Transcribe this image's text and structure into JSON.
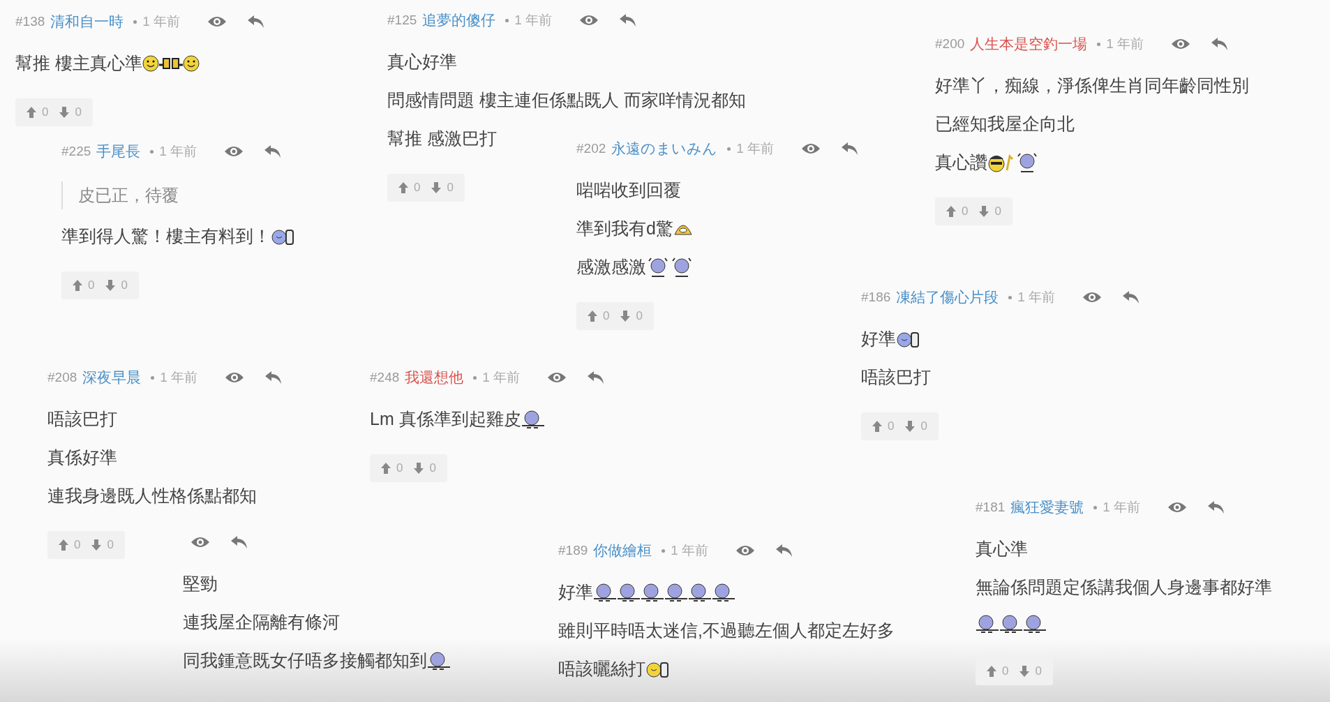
{
  "comments": [
    {
      "number": "#138",
      "name": "清和自一時",
      "color": "#4a90c8",
      "time": "1 年前",
      "lines": [
        {
          "kind": "text",
          "text": "幫推 樓主真心準",
          "emoticons": [
            {
              "kind": "smiley"
            },
            {
              "kind": "cheers"
            },
            {
              "kind": "smiley"
            }
          ]
        }
      ],
      "votes": {
        "up": "0",
        "down": "0"
      }
    },
    {
      "number": "#225",
      "name": "手尾長",
      "color": "#4a90c8",
      "time": "1 年前",
      "lines": [
        {
          "kind": "quote",
          "text": "皮已正，待覆"
        },
        {
          "kind": "text",
          "text": "準到得人驚！樓主有料到！",
          "emoticons": [
            {
              "kind": "thumbs"
            }
          ]
        }
      ],
      "votes": {
        "up": "0",
        "down": "0"
      }
    },
    {
      "number": "#125",
      "name": "追夢的傻仔",
      "color": "#4a90c8",
      "time": "1 年前",
      "lines": [
        {
          "kind": "text",
          "text": "真心好準"
        },
        {
          "kind": "text",
          "text": "問感情問題 樓主連佢係點既人 而家咩情況都知"
        },
        {
          "kind": "text",
          "text": "幫推 感激巴打"
        }
      ],
      "votes": {
        "up": "0",
        "down": "0"
      }
    },
    {
      "number": "#202",
      "name": "永遠のまいみん",
      "color": "#4a90c8",
      "time": "1 年前",
      "lines": [
        {
          "kind": "text",
          "text": "啱啱收到回覆"
        },
        {
          "kind": "text",
          "text": "準到我有d驚",
          "emoticons": [
            {
              "kind": "shock"
            }
          ]
        },
        {
          "kind": "text",
          "text": "感激感激",
          "emoticons": [
            {
              "kind": "wave"
            },
            {
              "kind": "wave"
            }
          ]
        }
      ],
      "votes": {
        "up": "0",
        "down": "0"
      }
    },
    {
      "number": "#200",
      "name": "人生本是空釣一場",
      "color": "#d9534f",
      "time": "1 年前",
      "lines": [
        {
          "kind": "text",
          "text": "好準丫，痴線，淨係俾生肖同年齡同性別"
        },
        {
          "kind": "text",
          "text": "已經知我屋企向北"
        },
        {
          "kind": "text",
          "text": "真心讚",
          "emoticons": [
            {
              "kind": "cool"
            },
            {
              "kind": "wave"
            }
          ]
        }
      ],
      "votes": {
        "up": "0",
        "down": "0"
      }
    },
    {
      "number": "#186",
      "name": "凍結了傷心片段",
      "color": "#4a90c8",
      "time": "1 年前",
      "lines": [
        {
          "kind": "text",
          "text": "好準",
          "emoticons": [
            {
              "kind": "thumbs"
            }
          ]
        },
        {
          "kind": "text",
          "text": "唔該巴打"
        }
      ],
      "votes": {
        "up": "0",
        "down": "0"
      }
    },
    {
      "number": "#208",
      "name": "深夜早晨",
      "color": "#4a90c8",
      "time": "1 年前",
      "lines": [
        {
          "kind": "text",
          "text": "唔該巴打"
        },
        {
          "kind": "text",
          "text": "真係好準"
        },
        {
          "kind": "text",
          "text": "連我身邊既人性格係點都知"
        }
      ],
      "votes": {
        "up": "0",
        "down": "0"
      }
    },
    {
      "number": "#248",
      "name": "我還想他",
      "color": "#d9534f",
      "time": "1 年前",
      "lines": [
        {
          "kind": "text",
          "text": "Lm 真係準到起雞皮",
          "emoticons": [
            {
              "kind": "blob"
            }
          ]
        }
      ],
      "votes": {
        "up": "0",
        "down": "0"
      }
    },
    {
      "lines": [
        {
          "kind": "text",
          "text": "堅勁"
        },
        {
          "kind": "text",
          "text": "連我屋企隔離有條河"
        },
        {
          "kind": "text",
          "text": "同我鍾意既女仔唔多接觸都知到",
          "emoticons": [
            {
              "kind": "blob"
            }
          ]
        }
      ]
    },
    {
      "number": "#189",
      "name": "你做繪桓",
      "color": "#4a90c8",
      "time": "1 年前",
      "lines": [
        {
          "kind": "text",
          "text": "好準",
          "emoticons": [
            {
              "kind": "blob"
            },
            {
              "kind": "blob"
            },
            {
              "kind": "blob"
            },
            {
              "kind": "blob"
            },
            {
              "kind": "blob"
            },
            {
              "kind": "blob"
            }
          ]
        },
        {
          "kind": "text",
          "text": "雖則平時唔太迷信,不過聽左個人都定左好多"
        },
        {
          "kind": "text",
          "text": "唔該曬絲打",
          "emoticons": [
            {
              "kind": "yellow-thumbs"
            }
          ]
        }
      ]
    },
    {
      "number": "#181",
      "name": "瘋狂愛妻號",
      "color": "#4a90c8",
      "time": "1 年前",
      "lines": [
        {
          "kind": "text",
          "text": "真心準"
        },
        {
          "kind": "text",
          "text": "無論係問題定係講我個人身邊事都好準"
        },
        {
          "kind": "emoticons",
          "emoticons": [
            {
              "kind": "blob"
            },
            {
              "kind": "blob"
            },
            {
              "kind": "blob"
            }
          ]
        }
      ],
      "votes": {
        "up": "0",
        "down": "0"
      }
    }
  ]
}
